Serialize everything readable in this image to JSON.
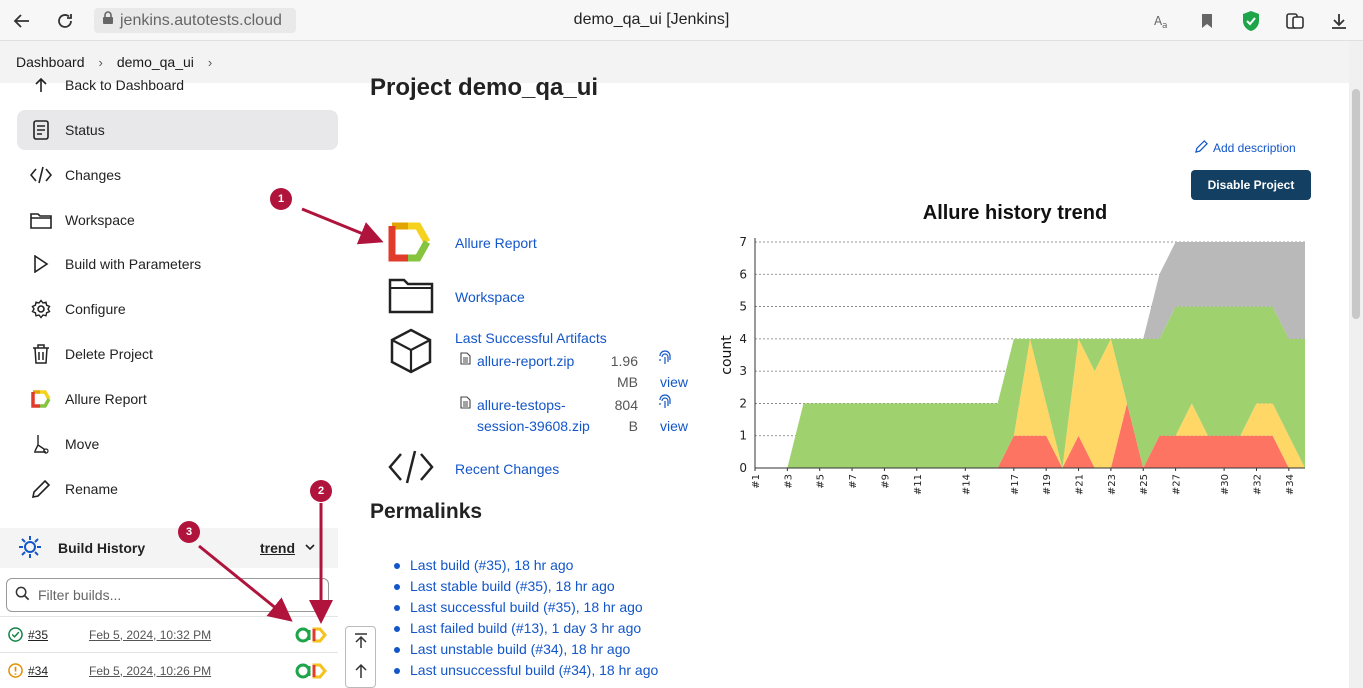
{
  "browser": {
    "url": "jenkins.autotests.cloud",
    "window_title": "demo_qa_ui [Jenkins]",
    "icons": [
      "back-icon",
      "reload-icon",
      "lock-icon",
      "translate-icon",
      "bookmark-icon",
      "shield-icon",
      "collections-icon",
      "download-icon"
    ]
  },
  "breadcrumb": {
    "items": [
      "Dashboard",
      "demo_qa_ui"
    ]
  },
  "sidebar": {
    "items": [
      {
        "label": "Back to Dashboard",
        "icon": "arrow-up-icon"
      },
      {
        "label": "Status",
        "icon": "document-icon"
      },
      {
        "label": "Changes",
        "icon": "code-icon"
      },
      {
        "label": "Workspace",
        "icon": "folder-icon"
      },
      {
        "label": "Build with Parameters",
        "icon": "play-icon"
      },
      {
        "label": "Configure",
        "icon": "gear-icon"
      },
      {
        "label": "Delete Project",
        "icon": "trash-icon"
      },
      {
        "label": "Allure Report",
        "icon": "allure-icon"
      },
      {
        "label": "Move",
        "icon": "move-icon"
      },
      {
        "label": "Rename",
        "icon": "pencil-icon"
      }
    ],
    "build_history": {
      "title": "Build History",
      "trend_label": "trend",
      "filter_placeholder": "Filter builds...",
      "builds": [
        {
          "number": "#35",
          "date": "Feb 5, 2024, 10:32 PM",
          "status": "success"
        },
        {
          "number": "#34",
          "date": "Feb 5, 2024, 10:26 PM",
          "status": "unstable"
        }
      ]
    }
  },
  "main": {
    "title": "Project demo_qa_ui",
    "add_description": "Add description",
    "disable_button": "Disable Project",
    "links": {
      "allure_report": "Allure Report",
      "workspace": "Workspace",
      "last_artifacts": "Last Successful Artifacts",
      "recent_changes": "Recent Changes"
    },
    "artifacts": [
      {
        "file_line1": "allure-report.zip",
        "file_line2": "",
        "size_line1": "1.96",
        "size_line2": "MB",
        "view": "view"
      },
      {
        "file_line1": "allure-testops-",
        "file_line2": "session-39608.zip",
        "size_line1": "804",
        "size_line2": "B",
        "view": "view"
      }
    ],
    "permalinks_title": "Permalinks",
    "permalinks": [
      "Last build (#35), 18 hr ago",
      "Last stable build (#35), 18 hr ago",
      "Last successful build (#35), 18 hr ago",
      "Last failed build (#13), 1 day 3 hr ago",
      "Last unstable build (#34), 18 hr ago",
      "Last unsuccessful build (#34), 18 hr ago"
    ]
  },
  "annotations": [
    "1",
    "2",
    "3"
  ],
  "colors": {
    "link": "#1356c9",
    "disable_button": "#123f62",
    "annotation": "#b0143c",
    "chart_failed": "#fd7562",
    "chart_broken": "#ffd766",
    "chart_passed": "#9fd16f",
    "chart_skipped": "#b9b9b9"
  },
  "chart_data": {
    "type": "area",
    "title": "Allure history trend",
    "ylabel": "count",
    "xlabel": "",
    "ylim": [
      0,
      7
    ],
    "yticks": [
      0,
      1,
      2,
      3,
      4,
      5,
      6,
      7
    ],
    "grid": true,
    "x": [
      "#1",
      "#2",
      "#3",
      "#4",
      "#5",
      "#6",
      "#7",
      "#8",
      "#9",
      "#10",
      "#11",
      "#12",
      "#13",
      "#14",
      "#15",
      "#16",
      "#17",
      "#18",
      "#19",
      "#20",
      "#21",
      "#22",
      "#23",
      "#24",
      "#25",
      "#26",
      "#27",
      "#28",
      "#29",
      "#30",
      "#31",
      "#32",
      "#33",
      "#34",
      "#35"
    ],
    "xtick_labels": [
      "#1",
      "#3",
      "#5",
      "#7",
      "#9",
      "#11",
      "#14",
      "#17",
      "#19",
      "#21",
      "#23",
      "#25",
      "#27",
      "#30",
      "#32",
      "#34"
    ],
    "series": [
      {
        "name": "failed",
        "values": [
          0,
          0,
          0,
          0,
          0,
          0,
          0,
          0,
          0,
          0,
          0,
          0,
          0,
          0,
          0,
          0,
          1,
          1,
          1,
          0,
          1,
          0,
          0,
          2,
          0,
          1,
          1,
          1,
          1,
          1,
          1,
          1,
          1,
          0,
          0
        ]
      },
      {
        "name": "broken",
        "values": [
          0,
          0,
          0,
          0,
          0,
          0,
          0,
          0,
          0,
          0,
          0,
          0,
          0,
          0,
          0,
          0,
          0,
          3,
          1,
          0,
          3,
          3,
          4,
          0,
          0,
          0,
          0,
          1,
          0,
          0,
          0,
          1,
          1,
          1,
          0
        ]
      },
      {
        "name": "passed",
        "values": [
          0,
          0,
          0,
          2,
          2,
          2,
          2,
          2,
          2,
          2,
          2,
          2,
          2,
          2,
          2,
          2,
          3,
          0,
          2,
          4,
          0,
          1,
          0,
          2,
          4,
          3,
          4,
          3,
          4,
          4,
          4,
          3,
          3,
          3,
          4
        ]
      },
      {
        "name": "skipped",
        "values": [
          0,
          0,
          0,
          0,
          0,
          0,
          0,
          0,
          0,
          0,
          0,
          0,
          0,
          0,
          0,
          0,
          0,
          0,
          0,
          0,
          0,
          0,
          0,
          0,
          0,
          2,
          2,
          2,
          2,
          2,
          2,
          2,
          2,
          3,
          3
        ]
      }
    ]
  }
}
